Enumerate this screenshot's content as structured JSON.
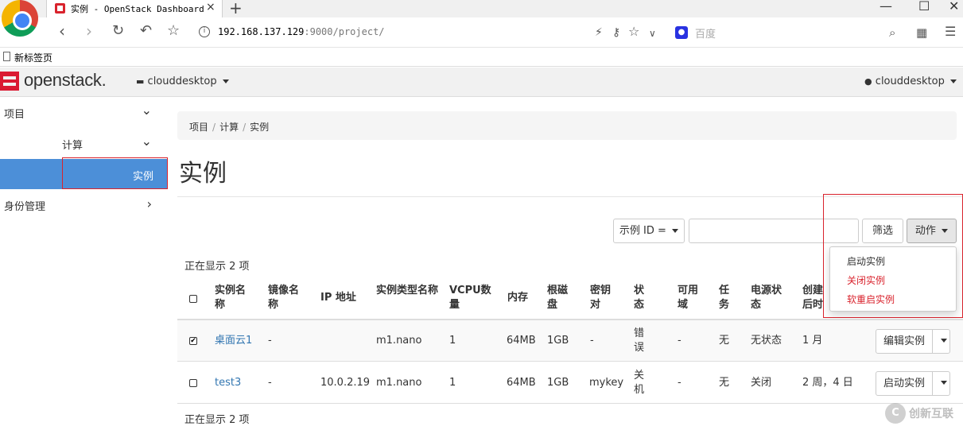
{
  "browser": {
    "tab_title": "实例 - OpenStack Dashboard",
    "tab_close": "×",
    "new_tab": "+",
    "url_host": "192.168.137.129",
    "url_rest": ":9000/project/",
    "search_placeholder": "百度",
    "bookmark_label": "新标签页",
    "icons": [
      "back-icon",
      "forward-icon",
      "reload-icon",
      "undo-icon",
      "star-icon",
      "info-icon",
      "lightning-icon",
      "key-icon",
      "star-icon",
      "chevron-down-icon",
      "baidu-icon",
      "search-icon",
      "qr-icon",
      "menu-icon"
    ]
  },
  "header": {
    "logo_text": "openstack.",
    "project": "clouddesktop",
    "user": "clouddesktop",
    "brand_color": "#da1a32"
  },
  "sidebar": {
    "project": "项目",
    "compute": "计算",
    "instances": "实例",
    "identity": "身份管理",
    "active_color": "#4c8fd8"
  },
  "main": {
    "breadcrumb": [
      "项目",
      "计算",
      "实例"
    ],
    "title": "实例",
    "filter_select": "示例 ID =",
    "filter_value": "",
    "filter_button": "筛选",
    "action_button": "动作",
    "action_menu": [
      {
        "label": "启动实例",
        "color": "#333333"
      },
      {
        "label": "关闭实例",
        "color": "#d9232d"
      },
      {
        "label": "软重启实例",
        "color": "#d9232d"
      }
    ],
    "count_top": "正在显示 2 项",
    "count_bottom": "正在显示 2 项"
  },
  "table": {
    "headers": [
      "实例名称",
      "镜像名称",
      "IP 地址",
      "实例类型名称",
      "VCPU数量",
      "内存",
      "根磁盘",
      "密钥对",
      "状态",
      "可用域",
      "任务",
      "电源状态",
      "创建后时间"
    ],
    "rows": [
      {
        "checked": true,
        "check_mark": "✔",
        "name": "桌面云1",
        "image": "-",
        "ip": "",
        "flavor": "m1.nano",
        "vcpu": "1",
        "ram": "64MB",
        "disk": "1GB",
        "key": "-",
        "status": "错误",
        "zone": "-",
        "task": "无",
        "power": "无状态",
        "age": "1 月",
        "action": "编辑实例"
      },
      {
        "checked": false,
        "check_mark": "",
        "name": "test3",
        "image": "-",
        "ip": "10.0.2.19",
        "flavor": "m1.nano",
        "vcpu": "1",
        "ram": "64MB",
        "disk": "1GB",
        "key": "mykey",
        "status": "关机",
        "zone": "-",
        "task": "无",
        "power": "关闭",
        "age": "2 周，4 日",
        "action": "启动实例"
      }
    ],
    "link_color": "#3276b1"
  },
  "watermark": {
    "icon_text": "C",
    "text": "创新互联"
  }
}
